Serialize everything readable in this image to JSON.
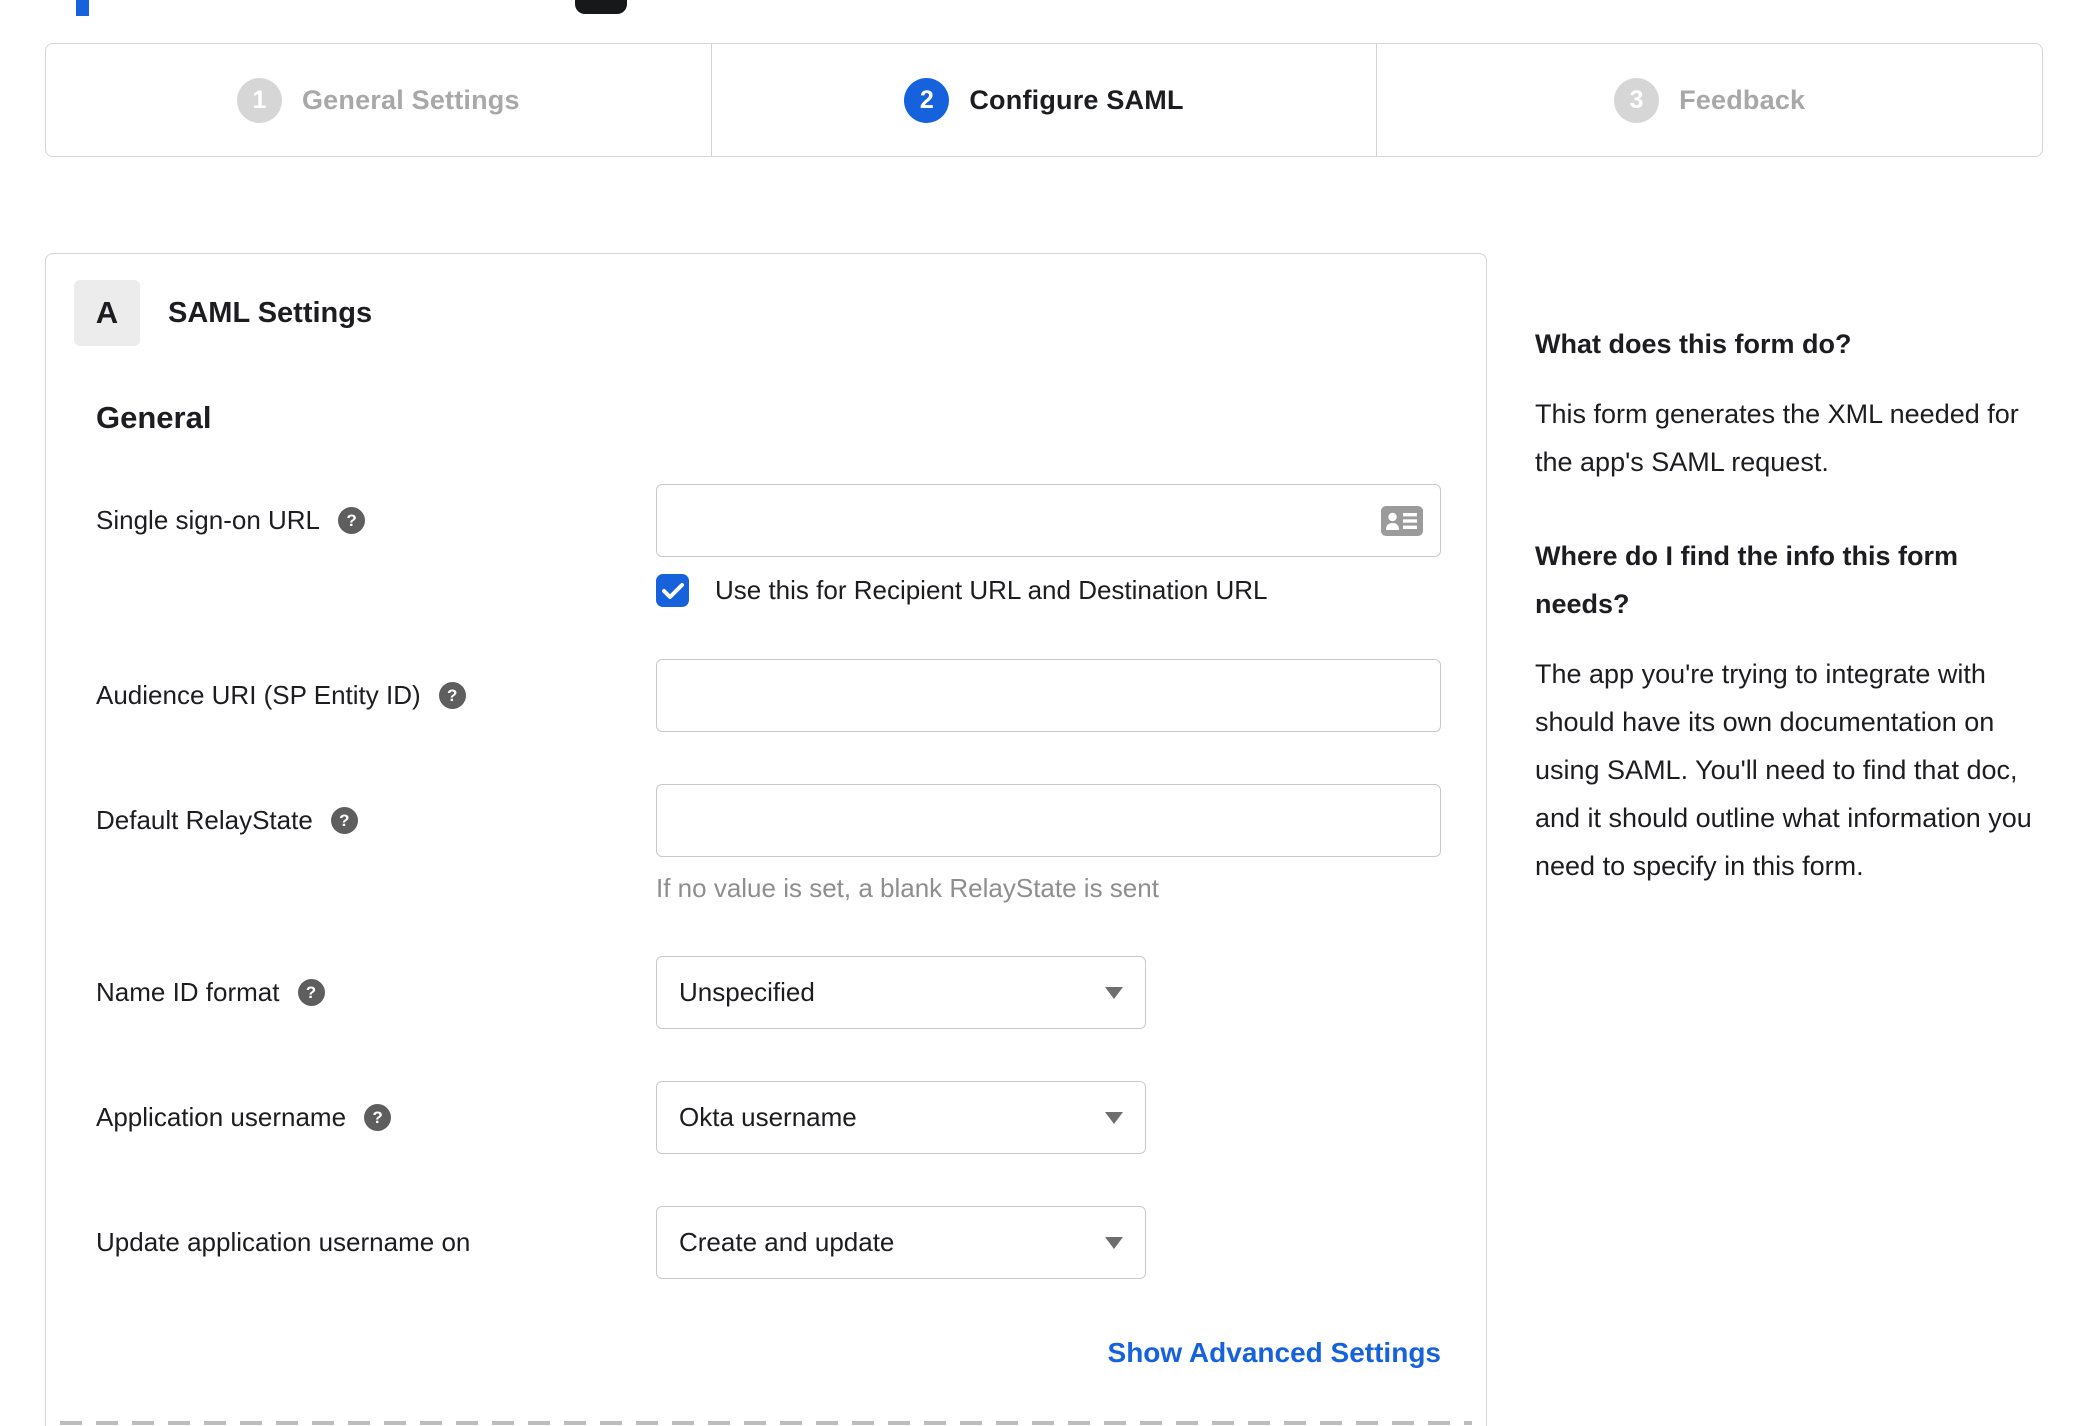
{
  "stepper": {
    "steps": [
      {
        "number": "1",
        "label": "General Settings",
        "state": "inactive"
      },
      {
        "number": "2",
        "label": "Configure SAML",
        "state": "active"
      },
      {
        "number": "3",
        "label": "Feedback",
        "state": "inactive"
      }
    ]
  },
  "panel": {
    "section_letter": "A",
    "section_title": "SAML Settings",
    "group_heading": "General",
    "fields": {
      "sso_url": {
        "label": "Single sign-on URL",
        "value": "",
        "checkbox_label": "Use this for Recipient URL and Destination URL",
        "checkbox_checked": true
      },
      "audience_uri": {
        "label": "Audience URI (SP Entity ID)",
        "value": ""
      },
      "relay_state": {
        "label": "Default RelayState",
        "value": "",
        "hint": "If no value is set, a blank RelayState is sent"
      },
      "name_id_format": {
        "label": "Name ID format",
        "value": "Unspecified"
      },
      "app_username": {
        "label": "Application username",
        "value": "Okta username"
      },
      "update_username": {
        "label": "Update application username on",
        "value": "Create and update"
      }
    },
    "advanced_link": "Show Advanced Settings"
  },
  "help_sidebar": {
    "sections": [
      {
        "heading": "What does this form do?",
        "body": "This form generates the XML needed for the app's SAML request."
      },
      {
        "heading": "Where do I find the info this form needs?",
        "body": "The app you're trying to integrate with should have its own documentation on using SAML. You'll need to find that doc, and it should outline what information you need to specify in this form."
      }
    ]
  },
  "icons": {
    "help_glyph": "?"
  },
  "colors": {
    "accent_blue": "#1662dd",
    "text": "#1d1d21",
    "inactive_gray": "#a8a8a8",
    "border": "#d4d4d4",
    "input_border": "#c9c9c9",
    "help_icon_bg": "#5e5e5e",
    "hint_gray": "#8e8e8e"
  }
}
